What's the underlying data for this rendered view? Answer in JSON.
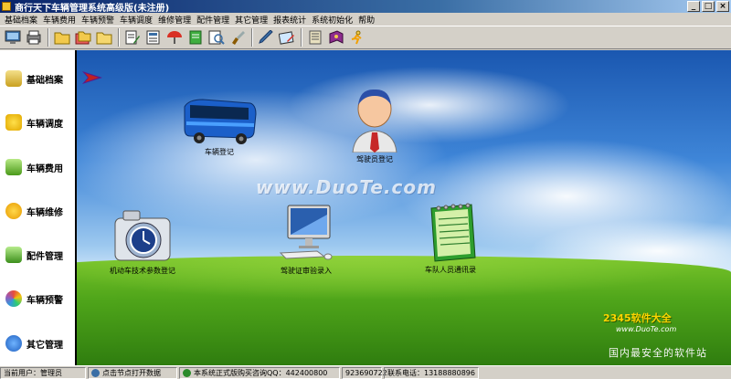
{
  "window": {
    "title": "商行天下车辆管理系统高级版(未注册)"
  },
  "menu": [
    "基础档案",
    "车辆费用",
    "车辆预警",
    "车辆调度",
    "维修管理",
    "配件管理",
    "其它管理",
    "报表统计",
    "系统初始化",
    "帮助"
  ],
  "toolbar_icons": [
    "monitor-icon",
    "printer-icon",
    "folder-icon",
    "folders-icon",
    "folder-open-icon",
    "document-edit-icon",
    "document-list-icon",
    "umbrella-icon",
    "green-book-icon",
    "search-document-icon",
    "brush-icon",
    "pen-icon",
    "document-pencil-icon",
    "notebook-icon",
    "book-icon",
    "runner-icon"
  ],
  "leftnav": [
    {
      "label": "基础档案",
      "icon": "archive-icon"
    },
    {
      "label": "车辆调度",
      "icon": "dispatch-icon"
    },
    {
      "label": "车辆费用",
      "icon": "car-cost-icon"
    },
    {
      "label": "车辆维修",
      "icon": "repair-icon"
    },
    {
      "label": "配件管理",
      "icon": "parts-icon"
    },
    {
      "label": "车辆预警",
      "icon": "warning-icon"
    },
    {
      "label": "其它管理",
      "icon": "other-icon"
    }
  ],
  "functions": {
    "vehicle_reg": "车辆登记",
    "driver_reg": "驾驶员登记",
    "tech_params": "机动车技术参数登记",
    "license_review": "驾驶证审验录入",
    "fleet_contacts": "车队人员通讯录"
  },
  "watermark": "www.DuoTe.com",
  "brand": {
    "name": "2345软件大全",
    "url": "www.DuoTe.com",
    "slogan": "国内最安全的软件站"
  },
  "status": {
    "user": "当前用户：管理员",
    "tip": "点击节点打开数据",
    "purchase": "本系统正式版购买咨询QQ：442400800",
    "qq2": "923690722",
    "phone": "联系电话：13188880896"
  },
  "colors": {
    "titlebar": "#0a246a",
    "sky": "#3f86d8",
    "grass": "#4fa51a"
  }
}
